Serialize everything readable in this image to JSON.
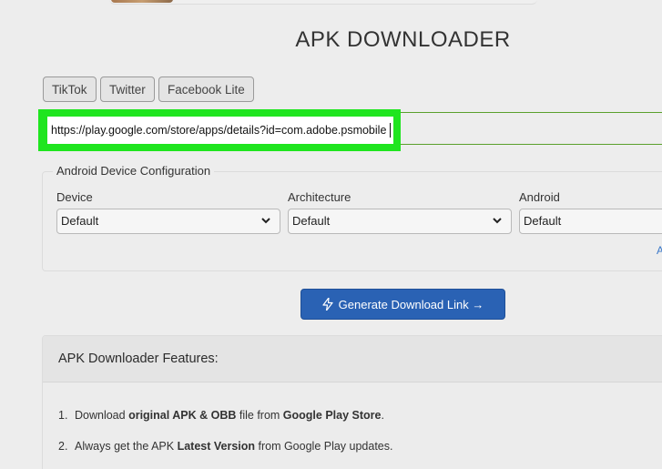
{
  "header": {
    "title": "APK DOWNLOADER"
  },
  "quick_links": [
    "TikTok",
    "Twitter",
    "Facebook Lite"
  ],
  "url_input": {
    "value": "https://play.google.com/store/apps/details?id=com.adobe.psmobile",
    "highlight_color": "#1fe51f"
  },
  "config": {
    "legend": "Android Device Configuration",
    "fields": [
      {
        "label": "Device",
        "selected": "Default"
      },
      {
        "label": "Architecture",
        "selected": "Default"
      },
      {
        "label": "Android",
        "selected": "Default"
      }
    ],
    "cut_link": "A"
  },
  "generate_button": {
    "label": "Generate Download Link →",
    "icon": "bolt-icon",
    "color": "#2a62b4"
  },
  "features": {
    "title": "APK Downloader Features:",
    "items": [
      {
        "num": "1.",
        "parts": [
          "Download ",
          "original",
          " APK & OBB",
          " file from ",
          "Google Play Store",
          "."
        ]
      },
      {
        "num": "2.",
        "parts": [
          "Always get the APK ",
          "Latest Version",
          " from Google Play updates."
        ]
      }
    ]
  }
}
